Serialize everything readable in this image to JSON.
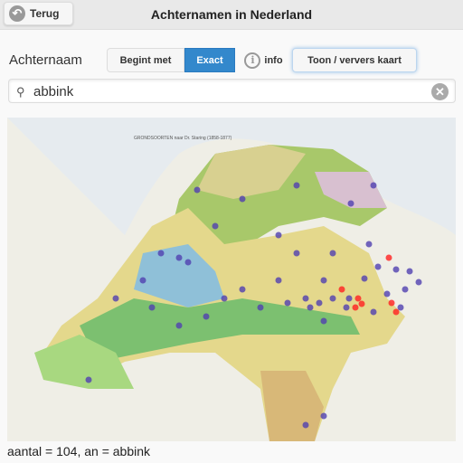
{
  "header": {
    "back_label": "Terug",
    "back_icon": "undo-arrow-icon",
    "title": "Achternamen in Nederland"
  },
  "controls": {
    "label": "Achternaam",
    "begint_met": "Begint met",
    "exact": "Exact",
    "info_icon": "info-icon",
    "info": "info",
    "toon": "Toon / ververs kaart",
    "selected": "Exact",
    "accent": "#3388cc"
  },
  "search": {
    "value": "abbink",
    "search_icon": "search-icon",
    "clear_icon": "clear-icon"
  },
  "map": {
    "map_title": "GRONDSOORTEN naar Dr. Staring (1858-1877)",
    "dot_colors": {
      "few": "#5040b0",
      "many": "#ff2020"
    }
  },
  "footer": {
    "text": "aantal = 104, an = abbink"
  }
}
